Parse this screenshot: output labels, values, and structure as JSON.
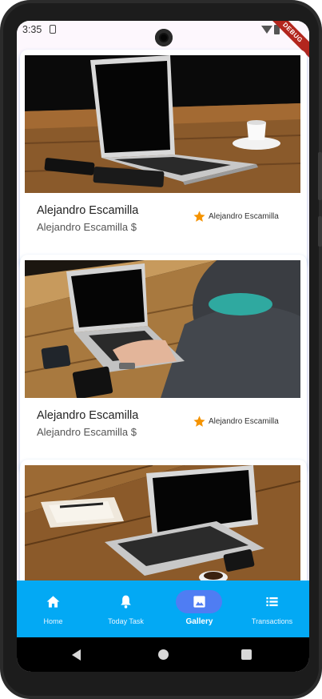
{
  "status_bar": {
    "time": "3:35",
    "debug_label": "DEBUG"
  },
  "feed": {
    "cards": [
      {
        "title": "Alejandro Escamilla",
        "subtitle": "Alejandro Escamilla $",
        "author": "Alejandro Escamilla",
        "image": "laptop-on-wooden-table-with-coffee"
      },
      {
        "title": "Alejandro Escamilla",
        "subtitle": "Alejandro Escamilla $",
        "author": "Alejandro Escamilla",
        "image": "person-typing-on-laptop"
      },
      {
        "title": "",
        "subtitle": "",
        "author": "",
        "image": "laptop-with-notebook-on-table"
      }
    ]
  },
  "bottom_nav": {
    "items": [
      {
        "label": "Home",
        "icon": "home-icon",
        "active": false
      },
      {
        "label": "Today Task",
        "icon": "bell-icon",
        "active": false
      },
      {
        "label": "Gallery",
        "icon": "image-icon",
        "active": true
      },
      {
        "label": "Transactions",
        "icon": "list-icon",
        "active": false
      }
    ]
  },
  "colors": {
    "nav_background": "#03a9f4",
    "nav_active_pill": "#4f7df3",
    "star": "#f59300",
    "debug_ribbon": "#b3261e"
  }
}
